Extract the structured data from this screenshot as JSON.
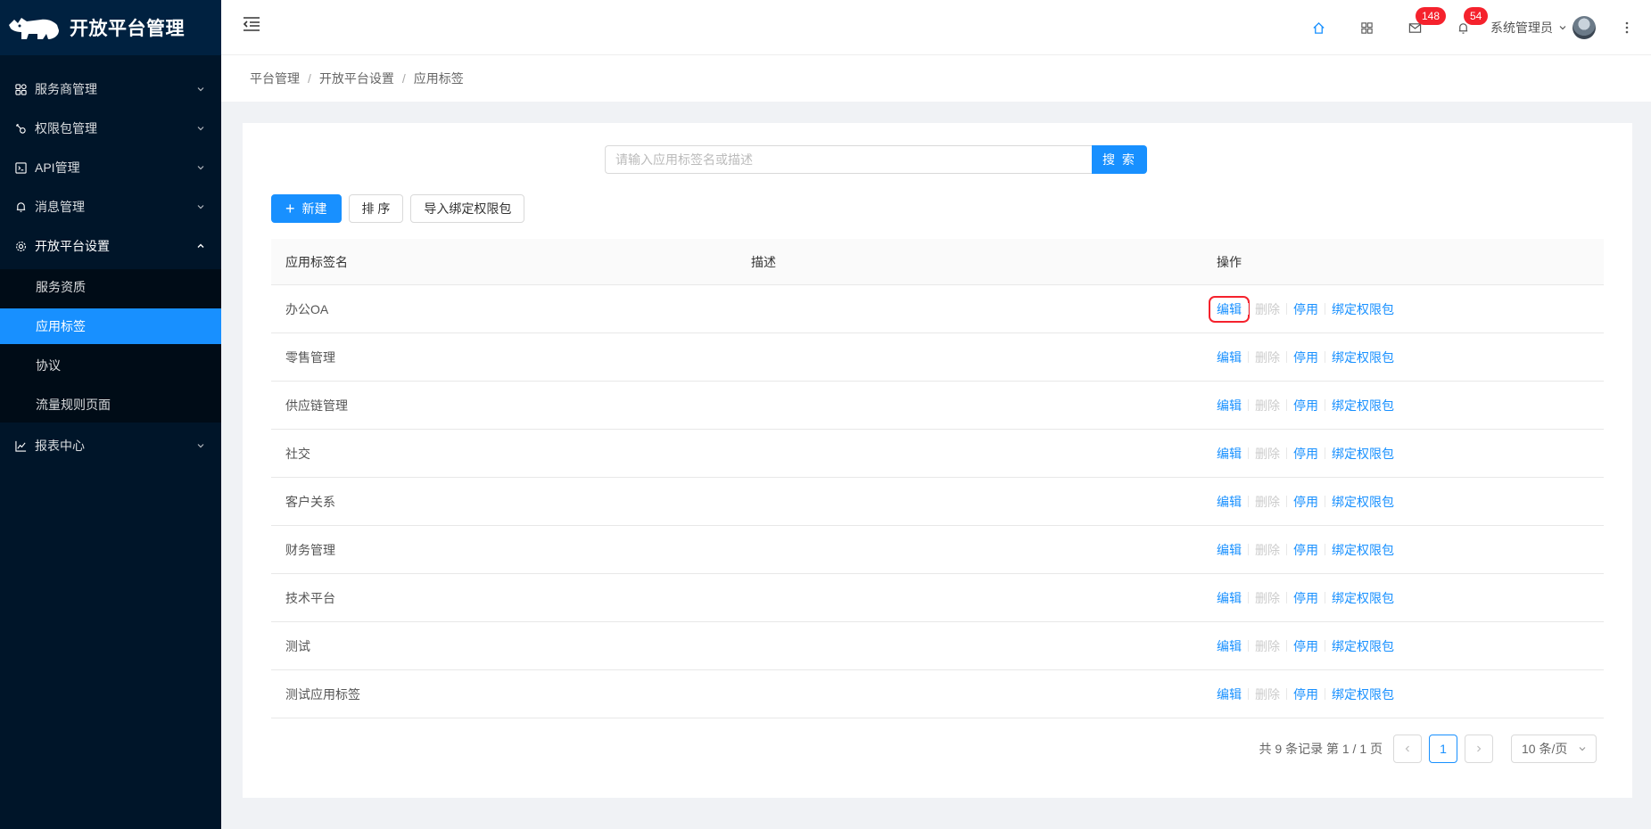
{
  "app": {
    "title": "开放平台管理"
  },
  "sidebar": {
    "items": [
      {
        "label": "服务商管理",
        "icon": "apps-icon"
      },
      {
        "label": "权限包管理",
        "icon": "key-icon"
      },
      {
        "label": "API管理",
        "icon": "code-icon"
      },
      {
        "label": "消息管理",
        "icon": "bell-icon"
      },
      {
        "label": "开放平台设置",
        "icon": "gear-icon",
        "open": true,
        "children": [
          "服务资质",
          "应用标签",
          "协议",
          "流量规则页面"
        ],
        "active": "应用标签"
      },
      {
        "label": "报表中心",
        "icon": "chart-icon"
      }
    ]
  },
  "header": {
    "mail_count": "148",
    "notify_count": "54",
    "user_name": "系统管理员"
  },
  "breadcrumb": [
    "平台管理",
    "开放平台设置",
    "应用标签"
  ],
  "search": {
    "placeholder": "请输入应用标签名或描述",
    "button": "搜 索"
  },
  "toolbar": {
    "new": "新建",
    "sort": "排 序",
    "import": "导入绑定权限包"
  },
  "table": {
    "columns": [
      "应用标签名",
      "描述",
      "操作"
    ],
    "rows": [
      {
        "name": "办公OA",
        "desc": ""
      },
      {
        "name": "零售管理",
        "desc": ""
      },
      {
        "name": "供应链管理",
        "desc": ""
      },
      {
        "name": "社交",
        "desc": ""
      },
      {
        "name": "客户关系",
        "desc": ""
      },
      {
        "name": "财务管理",
        "desc": ""
      },
      {
        "name": "技术平台",
        "desc": ""
      },
      {
        "name": "测试",
        "desc": ""
      },
      {
        "name": "测试应用标签",
        "desc": ""
      }
    ],
    "ops": {
      "edit": "编辑",
      "delete": "删除",
      "disable": "停用",
      "bind": "绑定权限包"
    }
  },
  "pagination": {
    "summary": "共 9 条记录 第 1 / 1 页",
    "current": "1",
    "page_size": "10 条/页"
  },
  "colors": {
    "primary": "#1890ff",
    "sidebar_bg": "#001529",
    "badge": "#f5222d"
  }
}
